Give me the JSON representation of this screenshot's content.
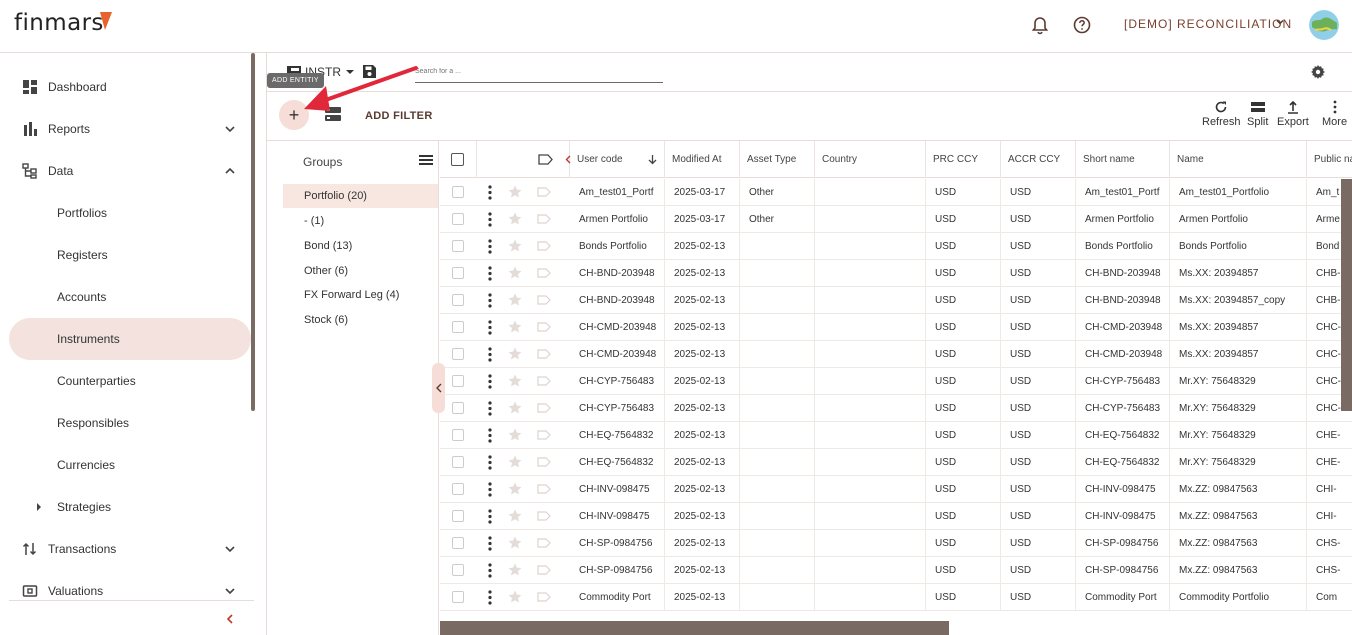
{
  "header": {
    "logo_text": "finmars",
    "workspace": "[DEMO] RECONCILIATION"
  },
  "sidebar": {
    "items": [
      {
        "label": "Dashboard",
        "icon": "dashboard-icon"
      },
      {
        "label": "Reports",
        "icon": "reports-icon",
        "chevron": "down"
      },
      {
        "label": "Data",
        "icon": "data-icon",
        "chevron": "up"
      },
      {
        "label": "Portfolios"
      },
      {
        "label": "Registers"
      },
      {
        "label": "Accounts"
      },
      {
        "label": "Instruments",
        "active": true
      },
      {
        "label": "Counterparties"
      },
      {
        "label": "Responsibles"
      },
      {
        "label": "Currencies"
      },
      {
        "label": "Strategies",
        "expandable": true
      },
      {
        "label": "Transactions",
        "icon": "transactions-icon",
        "chevron": "down"
      },
      {
        "label": "Valuations",
        "icon": "valuations-icon",
        "chevron": "down"
      }
    ]
  },
  "toolbar": {
    "layout_name": "INSTR",
    "search_placeholder": "Search for a ...",
    "add_tooltip": "ADD ENTITIY",
    "add_filter_label": "ADD FILTER",
    "actions": {
      "refresh": "Refresh",
      "split": "Split",
      "export": "Export",
      "more": "More"
    }
  },
  "groups": {
    "title": "Groups",
    "items": [
      {
        "label": "Portfolio (20)",
        "active": true
      },
      {
        "label": "- (1)"
      },
      {
        "label": "Bond (13)"
      },
      {
        "label": "Other (6)"
      },
      {
        "label": "FX Forward Leg (4)"
      },
      {
        "label": "Stock (6)"
      }
    ]
  },
  "grid": {
    "columns": [
      "User code",
      "Modified At",
      "Asset Type",
      "Country",
      "PRC CCY",
      "ACCR CCY",
      "Short name",
      "Name",
      "Public na"
    ],
    "rows": [
      [
        "Am_test01_Portf",
        "2025-03-17",
        "Other",
        "",
        "USD",
        "USD",
        "Am_test01_Portf",
        "Am_test01_Portfolio",
        "Am_t"
      ],
      [
        "Armen Portfolio",
        "2025-03-17",
        "Other",
        "",
        "USD",
        "USD",
        "Armen Portfolio",
        "Armen Portfolio",
        "Arme"
      ],
      [
        "Bonds Portfolio",
        "2025-02-13",
        "",
        "",
        "USD",
        "USD",
        "Bonds Portfolio",
        "Bonds Portfolio",
        "Bond"
      ],
      [
        "CH-BND-203948",
        "2025-02-13",
        "",
        "",
        "USD",
        "USD",
        "CH-BND-203948",
        "Ms.XX: 20394857",
        "CHB-"
      ],
      [
        "CH-BND-203948",
        "2025-02-13",
        "",
        "",
        "USD",
        "USD",
        "CH-BND-203948",
        "Ms.XX: 20394857_copy",
        "CHB-"
      ],
      [
        "CH-CMD-203948",
        "2025-02-13",
        "",
        "",
        "USD",
        "USD",
        "CH-CMD-203948",
        "Ms.XX: 20394857",
        "CHC-"
      ],
      [
        "CH-CMD-203948",
        "2025-02-13",
        "",
        "",
        "USD",
        "USD",
        "CH-CMD-203948",
        "Ms.XX: 20394857",
        "CHC-"
      ],
      [
        "CH-CYP-756483",
        "2025-02-13",
        "",
        "",
        "USD",
        "USD",
        "CH-CYP-756483",
        "Mr.XY: 75648329",
        "CHC-"
      ],
      [
        "CH-CYP-756483",
        "2025-02-13",
        "",
        "",
        "USD",
        "USD",
        "CH-CYP-756483",
        "Mr.XY: 75648329",
        "CHC-"
      ],
      [
        "CH-EQ-7564832",
        "2025-02-13",
        "",
        "",
        "USD",
        "USD",
        "CH-EQ-7564832",
        "Mr.XY: 75648329",
        "CHE-"
      ],
      [
        "CH-EQ-7564832",
        "2025-02-13",
        "",
        "",
        "USD",
        "USD",
        "CH-EQ-7564832",
        "Mr.XY: 75648329",
        "CHE-"
      ],
      [
        "CH-INV-098475",
        "2025-02-13",
        "",
        "",
        "USD",
        "USD",
        "CH-INV-098475",
        "Mx.ZZ: 09847563",
        "CHI-"
      ],
      [
        "CH-INV-098475",
        "2025-02-13",
        "",
        "",
        "USD",
        "USD",
        "CH-INV-098475",
        "Mx.ZZ: 09847563",
        "CHI-"
      ],
      [
        "CH-SP-0984756",
        "2025-02-13",
        "",
        "",
        "USD",
        "USD",
        "CH-SP-0984756",
        "Mx.ZZ: 09847563",
        "CHS-"
      ],
      [
        "CH-SP-0984756",
        "2025-02-13",
        "",
        "",
        "USD",
        "USD",
        "CH-SP-0984756",
        "Mx.ZZ: 09847563",
        "CHS-"
      ],
      [
        "Commodity Port",
        "2025-02-13",
        "",
        "",
        "USD",
        "USD",
        "Commodity Port",
        "Commodity Portfolio",
        "Com"
      ]
    ]
  },
  "colors": {
    "accent": "#f6ddd7",
    "active_bg": "#f3e2dd",
    "brand_orange": "#e8622c",
    "annotation_arrow": "#e0283a",
    "scrollbar": "#7a6a64"
  }
}
